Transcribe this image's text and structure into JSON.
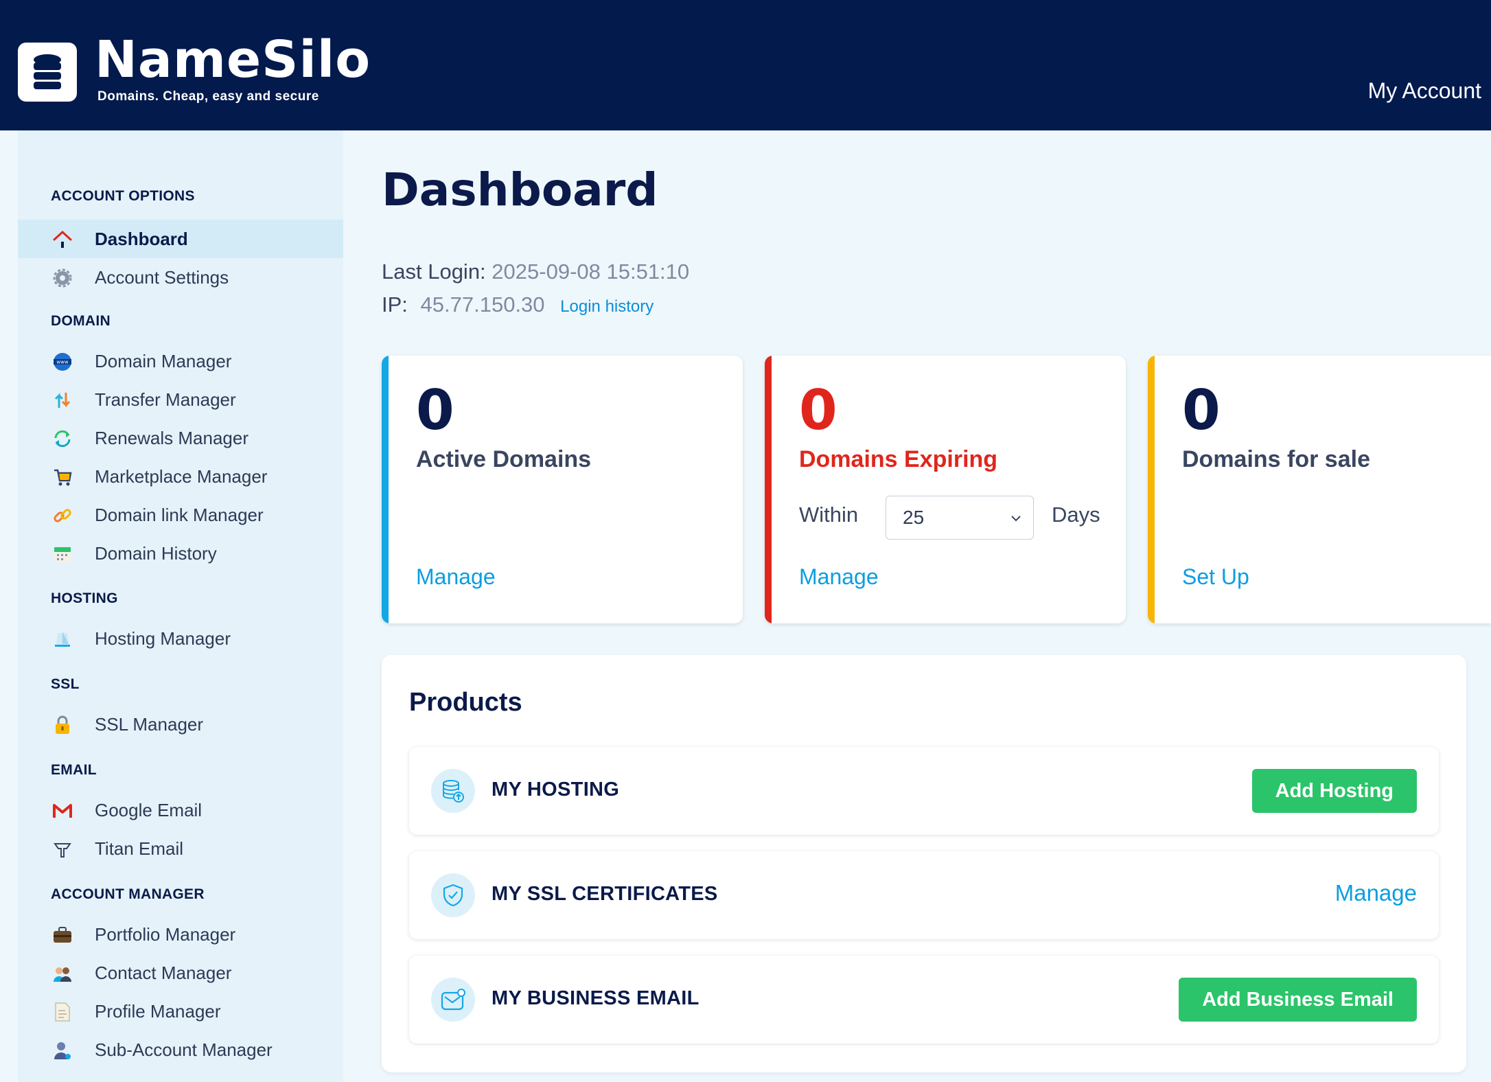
{
  "header": {
    "brand_name": "NameSilo",
    "brand_tagline": "Domains. Cheap, easy and secure",
    "account_link": "My Account"
  },
  "sidebar": {
    "sections": [
      {
        "title": "ACCOUNT OPTIONS",
        "items": [
          {
            "label": "Dashboard",
            "icon": "home-icon",
            "active": true
          },
          {
            "label": "Account Settings",
            "icon": "gear-icon"
          }
        ]
      },
      {
        "title": "DOMAIN",
        "items": [
          {
            "label": "Domain Manager",
            "icon": "www-globe-icon"
          },
          {
            "label": "Transfer Manager",
            "icon": "transfer-arrows-icon"
          },
          {
            "label": "Renewals Manager",
            "icon": "renew-arrows-icon"
          },
          {
            "label": "Marketplace Manager",
            "icon": "shopping-cart-icon"
          },
          {
            "label": "Domain link Manager",
            "icon": "link-icon"
          },
          {
            "label": "Domain History",
            "icon": "calendar-icon"
          }
        ]
      },
      {
        "title": "HOSTING",
        "items": [
          {
            "label": "Hosting Manager",
            "icon": "cloud-server-icon"
          }
        ]
      },
      {
        "title": "SSL",
        "items": [
          {
            "label": "SSL Manager",
            "icon": "lock-icon"
          }
        ]
      },
      {
        "title": "EMAIL",
        "items": [
          {
            "label": "Google Email",
            "icon": "gmail-icon"
          },
          {
            "label": "Titan Email",
            "icon": "titan-icon"
          }
        ]
      },
      {
        "title": "ACCOUNT MANAGER",
        "items": [
          {
            "label": "Portfolio Manager",
            "icon": "briefcase-icon"
          },
          {
            "label": "Contact Manager",
            "icon": "contacts-icon"
          },
          {
            "label": "Profile Manager",
            "icon": "document-icon"
          },
          {
            "label": "Sub-Account Manager",
            "icon": "user-icon"
          }
        ]
      }
    ]
  },
  "main": {
    "title": "Dashboard",
    "last_login_label": "Last Login:",
    "last_login_value": "2025-09-08 15:51:10",
    "ip_label": "IP:",
    "ip_value": "45.77.150.30",
    "login_history_link": "Login history"
  },
  "cards": {
    "active": {
      "count": "0",
      "label": "Active Domains",
      "link": "Manage",
      "accent": "#14a7e6"
    },
    "expiring": {
      "count": "0",
      "label": "Domains Expiring",
      "within_label": "Within",
      "days_value": "25",
      "days_label": "Days",
      "link": "Manage",
      "accent": "#e0261c"
    },
    "forsale": {
      "count": "0",
      "label": "Domains for sale",
      "link": "Set Up",
      "accent": "#f8b400"
    }
  },
  "products": {
    "title": "Products",
    "rows": [
      {
        "title": "MY HOSTING",
        "action": "Add Hosting",
        "icon": "database-upload-icon"
      },
      {
        "title": "MY SSL CERTIFICATES",
        "action": "Manage",
        "icon": "shield-check-icon"
      },
      {
        "title": "MY BUSINESS EMAIL",
        "action": "Add Business Email",
        "icon": "mail-notification-icon"
      }
    ]
  },
  "colors": {
    "header_bg": "#031a4d",
    "sidebar_bg": "#e5f2f9",
    "link_blue": "#0b9ee0",
    "button_green": "#2bc46a",
    "danger_red": "#e0261c"
  }
}
